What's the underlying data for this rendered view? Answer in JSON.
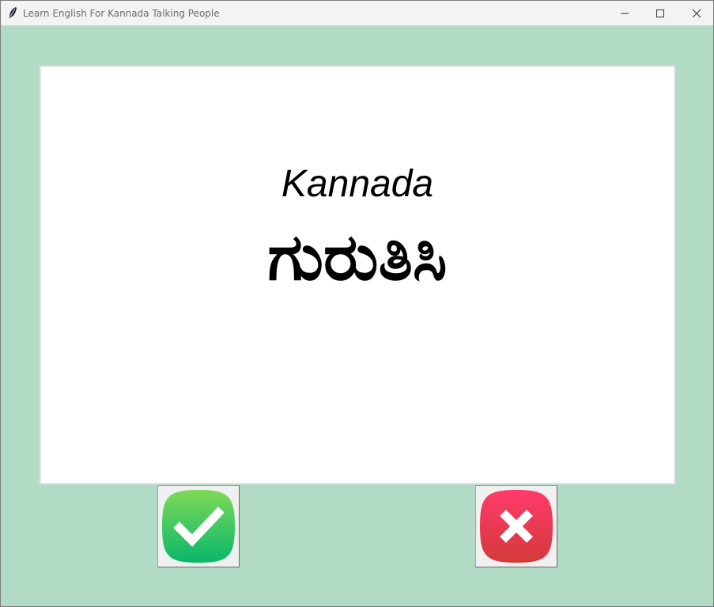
{
  "window": {
    "title": "Learn English For Kannada Talking People"
  },
  "card": {
    "language": "Kannada",
    "word": "ಗುರುತಿಸಿ"
  },
  "buttons": {
    "right_icon": "checkmark-icon",
    "wrong_icon": "cross-icon"
  },
  "colors": {
    "background": "#b1dbc5",
    "card": "#ffffff",
    "right_button_top": "#7ed957",
    "right_button_bottom": "#08b76b",
    "wrong_button_top": "#ff3b6b",
    "wrong_button_bottom": "#d43a3a"
  }
}
